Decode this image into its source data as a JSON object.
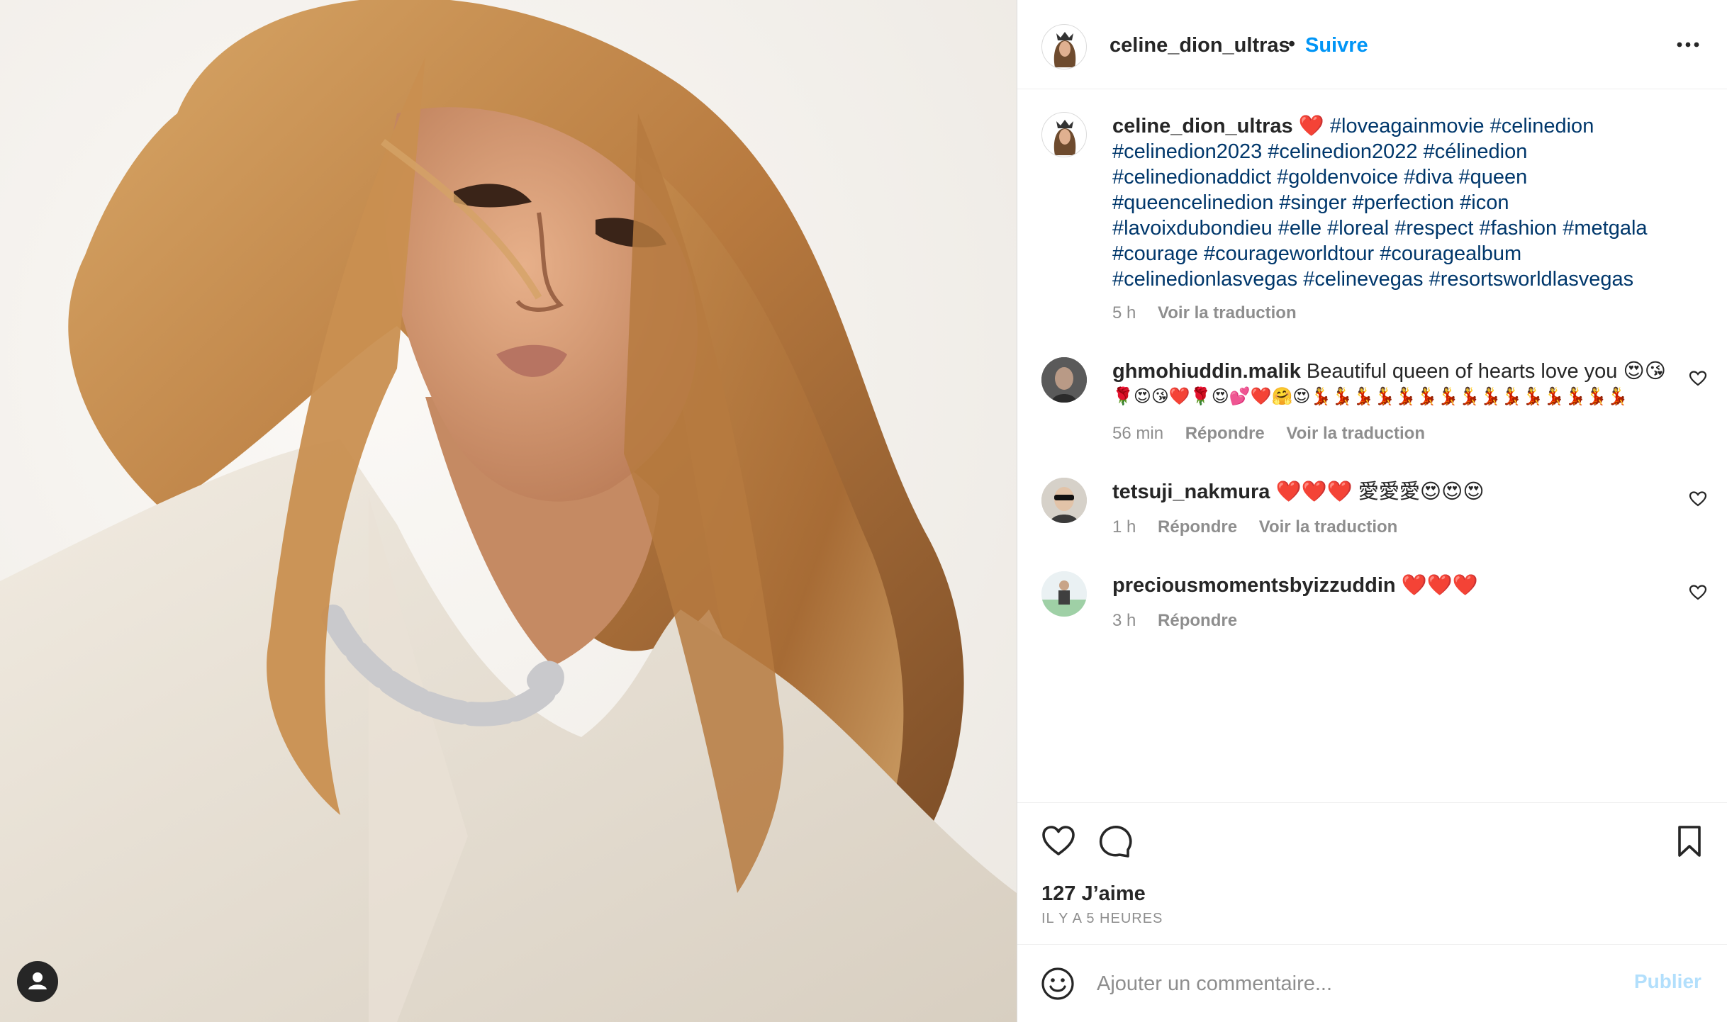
{
  "post": {
    "username": "celine_dion_ultras",
    "separator": "•",
    "follow_label": "Suivre",
    "caption": {
      "username": "celine_dion_ultras",
      "heart": "❤️",
      "line1_tags": "#loveagainmovie #celinedion",
      "line2": "#celinedion2023 #celinedion2022 #célinedion",
      "line3": "#celinedionaddict #goldenvoice #diva #queen",
      "line4": "#queencelinedion #singer #perfection #icon",
      "line5": "#lavoixdubondieu #elle #loreal #respect #fashion #metgala",
      "line6": "#courage #courageworldtour #couragealbum",
      "line7": "#celinedionlasvegas #celinevegas #resortsworldlasvegas",
      "time": "5 h",
      "translate": "Voir la traduction"
    }
  },
  "comments": [
    {
      "username": "ghmohiuddin.malik",
      "text": "Beautiful queen of hearts love you 😍😘",
      "text2": "🌹😍😘❤️🌹😍💕❤️🤗😍💃💃💃💃💃💃💃💃💃💃💃💃💃💃💃",
      "time": "56 min",
      "reply": "Répondre",
      "translate": "Voir la traduction"
    },
    {
      "username": "tetsuji_nakmura",
      "text": "❤️❤️❤️ 愛愛愛😍😍😍",
      "time": "1 h",
      "reply": "Répondre",
      "translate": "Voir la traduction"
    },
    {
      "username": "preciousmomentsbyizzuddin",
      "text": "❤️❤️❤️",
      "time": "3 h",
      "reply": "Répondre"
    }
  ],
  "footer": {
    "likes": "127 J’aime",
    "posted_ago": "IL Y A 5 HEURES",
    "comment_placeholder": "Ajouter un commentaire...",
    "publish_label": "Publier"
  },
  "icons": {
    "header_more": "more-horizontal-icon",
    "like": "heart-outline-icon",
    "comment": "comment-bubble-icon",
    "save": "bookmark-icon",
    "emoji": "smiley-icon",
    "profile": "user-profile-icon",
    "comment_like": "heart-small-icon"
  },
  "colors": {
    "accent": "#0095f6",
    "hashtag": "#00376b",
    "muted": "#8e8e8e",
    "publish_disabled": "#b2dffc"
  }
}
